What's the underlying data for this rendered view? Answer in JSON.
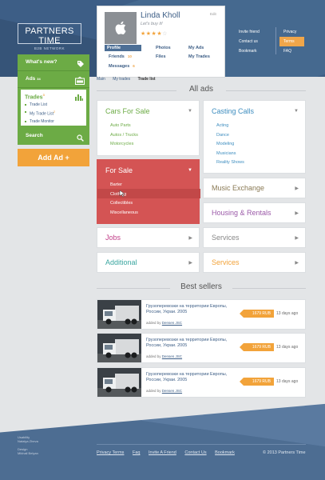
{
  "brand": {
    "title": "PARTNERS TIME",
    "subtitle": "B2B NETWORK"
  },
  "topnav": {
    "left": [
      "Invite friend",
      "Contact us",
      "Bookmark"
    ],
    "right": [
      "Privacy",
      "Terms",
      "FAQ"
    ],
    "selected": "Terms"
  },
  "profile": {
    "name": "Linda Kholl",
    "status": "Let's buy it!",
    "edit": "Edit",
    "rating": 4,
    "rating_max": 5,
    "menu": {
      "profile": "Profile",
      "photos": "Photos",
      "my_ads": "My Ads",
      "friends": "Friends",
      "friends_count": "10",
      "files": "Files",
      "my_trades": "My Trades",
      "messages": "Messages",
      "messages_count": "6"
    }
  },
  "sidebar": {
    "whats_new": "What's new?",
    "ads": "Ads",
    "ads_count": "34",
    "trades": "Trades",
    "trades_count": "3",
    "trade_items": [
      "Trade List",
      "My Trade List",
      "Trade Monitor"
    ],
    "my_trade_list_badge": "2",
    "search": "Search",
    "add_ad": "Add Ad +"
  },
  "breadcrumb": [
    "Main",
    "My trades",
    "Trade list"
  ],
  "all_ads_title": "All ads",
  "categories": {
    "cars": {
      "title": "Cars For Sale",
      "color": "#6cab45",
      "items": [
        "Auto Parts",
        "Autos / Trucks",
        "Motorcycles"
      ]
    },
    "casting": {
      "title": "Casting Calls",
      "color": "#3d8dbf",
      "items": [
        "Acting",
        "Dance",
        "Modeling",
        "Musicians",
        "Reality Shows"
      ]
    },
    "forsale": {
      "title": "For Sale",
      "color": "#d45454",
      "items": [
        "Barter",
        "Clothing",
        "Collectibles",
        "Miscellaneous"
      ]
    },
    "music": {
      "title": "Music Exchange",
      "color": "#8a7a55"
    },
    "housing": {
      "title": "Housing & Rentals",
      "color": "#9b5aa8"
    },
    "jobs": {
      "title": "Jobs",
      "color": "#c2418a"
    },
    "services_gray": {
      "title": "Services",
      "color": "#888888"
    },
    "additional": {
      "title": "Additional",
      "color": "#3aa6a0"
    },
    "services_orange": {
      "title": "Services",
      "color": "#f2a33a"
    }
  },
  "best_sellers_title": "Best sellers",
  "products": [
    {
      "title": "Грузоперевозки на территории Европы, России, Украи. 2005",
      "added_by": "added by",
      "seller": "Densen JSC",
      "price": "1679 RUB",
      "date": "13 days ago"
    },
    {
      "title": "Грузоперевозки на территории Европы, России, Украи. 2005",
      "added_by": "added by",
      "seller": "Densen JSC",
      "price": "1679 RUB",
      "date": "13 days ago"
    },
    {
      "title": "Грузоперевозки на территории Европы, России, Украи. 2005",
      "added_by": "added by",
      "seller": "Densen JSC",
      "price": "1679 RUB",
      "date": "13 days ago"
    },
    {
      "title": "Грузоперевозки на территории Европы, России, Украи. 2005",
      "added_by": "added by",
      "seller": "Densen JSC",
      "price": "1679 RUB",
      "date": "13 days ago"
    }
  ],
  "credits": [
    "Usability",
    "Natalya Zheva",
    "",
    "Design",
    "Mikhail Belyan"
  ],
  "footer": {
    "links": [
      "Privacy Terms",
      "Faq",
      "Invite A Friend",
      "Contact Us",
      "Bookmark"
    ],
    "copyright": "© 2013 Partners Time"
  }
}
